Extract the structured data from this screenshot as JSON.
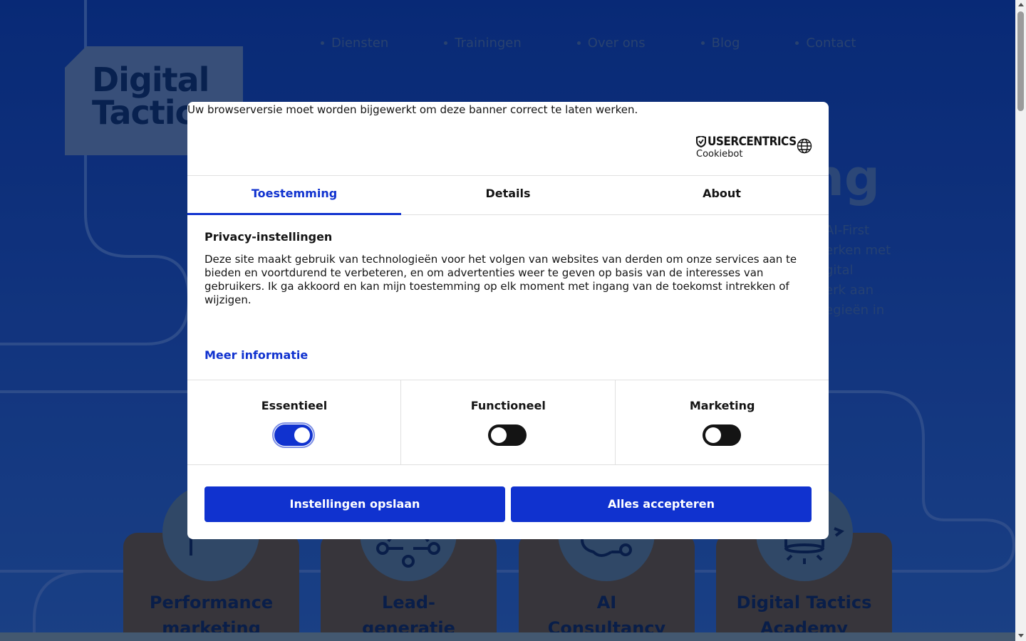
{
  "site": {
    "logo_line1": "Digital",
    "logo_line2": "Tactics",
    "nav": [
      "Diensten",
      "Trainingen",
      "Over ons",
      "Blog",
      "Contact"
    ],
    "hero_title_fragment": "ng",
    "hero_sub_lines": [
      "AI-First",
      "erken met",
      "gital",
      "erk aan",
      "egieën in"
    ],
    "cards": [
      {
        "title_line1": "Performance",
        "title_line2": "marketing",
        "icon": "megaphone-icon"
      },
      {
        "title_line1": "Lead-",
        "title_line2": "generatie",
        "icon": "network-icon"
      },
      {
        "title_line1": "AI",
        "title_line2": "Consultancy",
        "icon": "brain-icon"
      },
      {
        "title_line1": "Digital Tactics",
        "title_line2": "Academy",
        "icon": "academy-icon"
      }
    ]
  },
  "consent": {
    "browser_note": "Uw browserversie moet worden bijgewerkt om deze banner correct te laten werken.",
    "brand_name": "USERCENTRICS",
    "brand_sub": "Cookiebot",
    "tabs": [
      "Toestemming",
      "Details",
      "About"
    ],
    "active_tab": "Toestemming",
    "section_title": "Privacy-instellingen",
    "description": "Deze site maakt gebruik van technologieën voor het volgen van websites van derden om onze services aan te bieden en voortdurend te verbeteren, en om advertenties weer te geven op basis van de interesses van gebruikers. Ik ga akkoord en kan mijn toestemming op elk moment met ingang van de toekomst intrekken of wijzigen.",
    "more_info": "Meer informatie",
    "toggles": [
      {
        "label": "Essentieel",
        "on": true
      },
      {
        "label": "Functioneel",
        "on": false
      },
      {
        "label": "Marketing",
        "on": false
      }
    ],
    "save_button": "Instellingen opslaan",
    "accept_button": "Alles accepteren"
  },
  "colors": {
    "accent": "#1032cf",
    "page_bg": "#184ab2"
  }
}
